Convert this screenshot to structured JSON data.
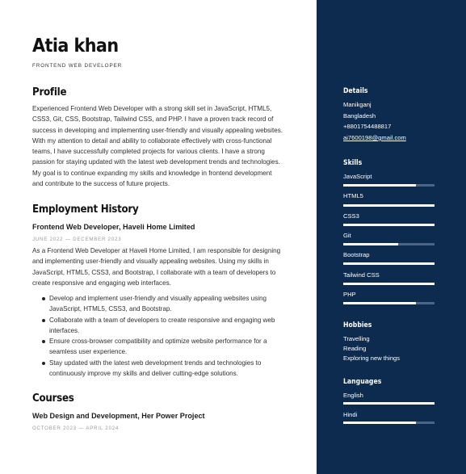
{
  "header": {
    "name": "Atia khan",
    "role": "FRONTEND WEB DEVELOPER"
  },
  "profile": {
    "heading": "Profile",
    "lines": [
      "Experienced Frontend Web Developer with a strong skill set in JavaScript, HTML5,",
      "CSS3, Git, CSS, Bootstrap, Tailwind CSS, and PHP. I have a proven track record of",
      "success in developing and implementing user-friendly and visually appealing websites.",
      "With my attention to detail and ability to collaborate effectively with cross-functional",
      "teams, I have successfully completed projects for various clients. I have a strong",
      "passion for staying updated with the latest web development trends and technologies.",
      "My goal is to continue expanding my skills and knowledge in frontend development",
      "and contribute to the success of future projects."
    ]
  },
  "employment": {
    "heading": "Employment History",
    "job_title": "Frontend Web Developer, Haveli Home Limited",
    "dates": "JUNE 2022 — DECEMBER 2023",
    "lines": [
      "As a Frontend Web Developer at Haveli Home Limited, I am responsible for designing",
      "and implementing user-friendly and visually appealing websites. Using my skills in",
      "JavaScript, HTML5, CSS3, and Bootstrap, I collaborate with a team of developers to",
      "create responsive and engaging web interfaces."
    ],
    "bullets": [
      [
        "Develop and implement user-friendly and visually appealing websites using",
        "JavaScript, HTML5, CSS3, and Bootstrap."
      ],
      [
        "Collaborate with a team of developers to create responsive and engaging web",
        "interfaces."
      ],
      [
        "Ensure cross-browser compatibility and optimize website performance for a",
        "seamless user experience."
      ],
      [
        "Stay updated with the latest web development trends and technologies to",
        "continuously improve my skills and deliver cutting-edge solutions."
      ]
    ]
  },
  "courses": {
    "heading": "Courses",
    "title": "Web Design and Development, Her Power Project",
    "dates": "OCTOBER 2023 — APRIL 2024"
  },
  "details": {
    "heading": "Details",
    "city": "Manikganj",
    "country": "Bangladesh",
    "phone": "+8801754488817",
    "email": "ai7600198@gmail.com"
  },
  "skills": {
    "heading": "Skills",
    "items": [
      {
        "name": "JavaScript",
        "level": 0.8
      },
      {
        "name": "HTML5",
        "level": 1.0
      },
      {
        "name": "CSS3",
        "level": 1.0
      },
      {
        "name": "Git",
        "level": 0.6
      },
      {
        "name": "Bootstrap",
        "level": 1.0
      },
      {
        "name": "Tailwind CSS",
        "level": 1.0
      },
      {
        "name": "PHP",
        "level": 0.8
      }
    ]
  },
  "hobbies": {
    "heading": "Hobbies",
    "items": [
      "Travelling",
      "Reading",
      "Exploring new things"
    ]
  },
  "languages": {
    "heading": "Languages",
    "items": [
      {
        "name": "English",
        "level": 1.0
      },
      {
        "name": "Hindi",
        "level": 0.8
      }
    ]
  }
}
